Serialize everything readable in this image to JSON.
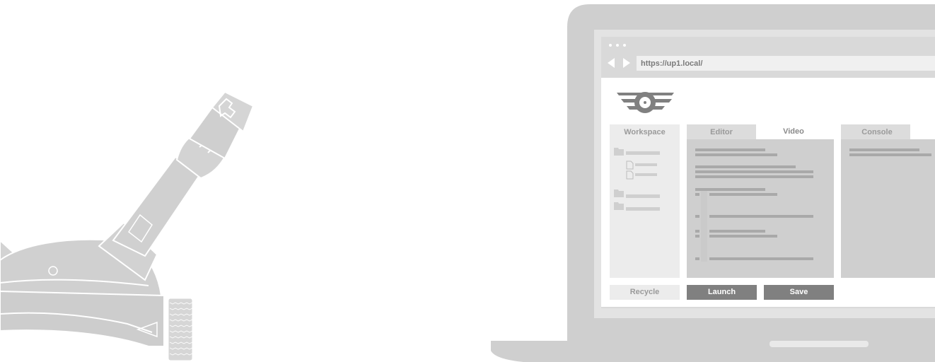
{
  "browser": {
    "url": "https://up1.local/",
    "dots_icon": "window-dots-icon",
    "back_icon": "back-arrow-icon",
    "forward_icon": "forward-arrow-icon"
  },
  "app": {
    "logo": "winged-target-logo",
    "tabs": {
      "workspace": "Workspace",
      "editor": "Editor",
      "video": "Video",
      "console": "Console"
    },
    "buttons": {
      "recycle": "Recycle",
      "launch": "Launch",
      "save": "Save"
    }
  },
  "colors": {
    "frame": "#cfcfcf",
    "panel": "#ececec",
    "button_dark": "#808080",
    "placeholder_lines": "#a9a9a9"
  }
}
